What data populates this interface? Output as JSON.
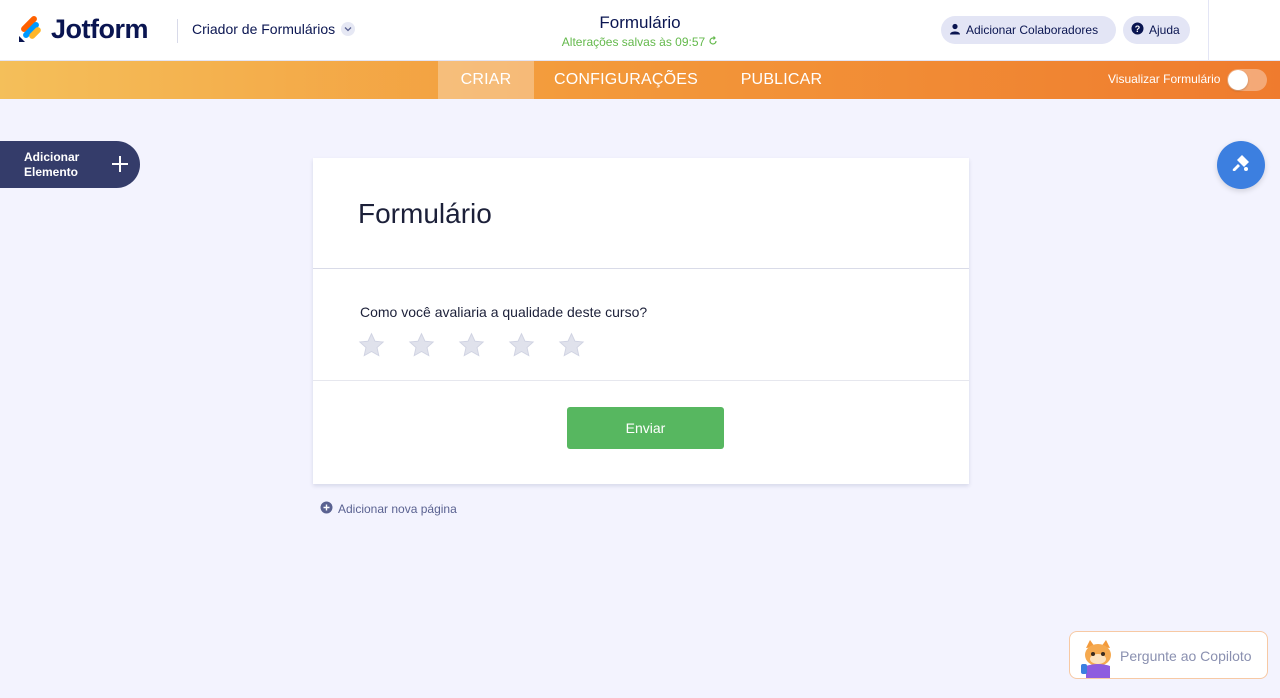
{
  "header": {
    "logo_text": "Jotform",
    "builder_label": "Criador de Formulários",
    "form_title": "Formulário",
    "saved_status": "Alterações salvas às 09:57",
    "collab_button": "Adicionar Colaboradores",
    "help_button": "Ajuda"
  },
  "nav": {
    "tabs": [
      {
        "label": "CRIAR",
        "active": true
      },
      {
        "label": "CONFIGURAÇÕES",
        "active": false
      },
      {
        "label": "PUBLICAR",
        "active": false
      }
    ],
    "preview_label": "Visualizar Formulário",
    "preview_enabled": false
  },
  "sidebar": {
    "add_element_label": "Adicionar Elemento"
  },
  "form": {
    "title": "Formulário",
    "question": "Como você avaliaria a qualidade deste curso?",
    "rating_max": 5,
    "rating_value": 0,
    "submit_label": "Enviar"
  },
  "add_page_label": "Adicionar nova página",
  "copilot": {
    "label": "Pergunte ao Copiloto"
  },
  "colors": {
    "brand_navy": "#0a1551",
    "nav_start": "#f4bf5a",
    "nav_end": "#ef7b2e",
    "submit_green": "#57b760",
    "fab_blue": "#3c7fe0",
    "saved_green": "#64b94c"
  },
  "icons": {
    "logo": "jotform-logo-icon",
    "chevron": "chevron-down-icon",
    "collab": "user-icon",
    "help": "question-circle-icon",
    "add": "plus-icon",
    "fab": "paint-roller-icon",
    "add_page": "plus-circle-icon",
    "star": "star-icon"
  }
}
